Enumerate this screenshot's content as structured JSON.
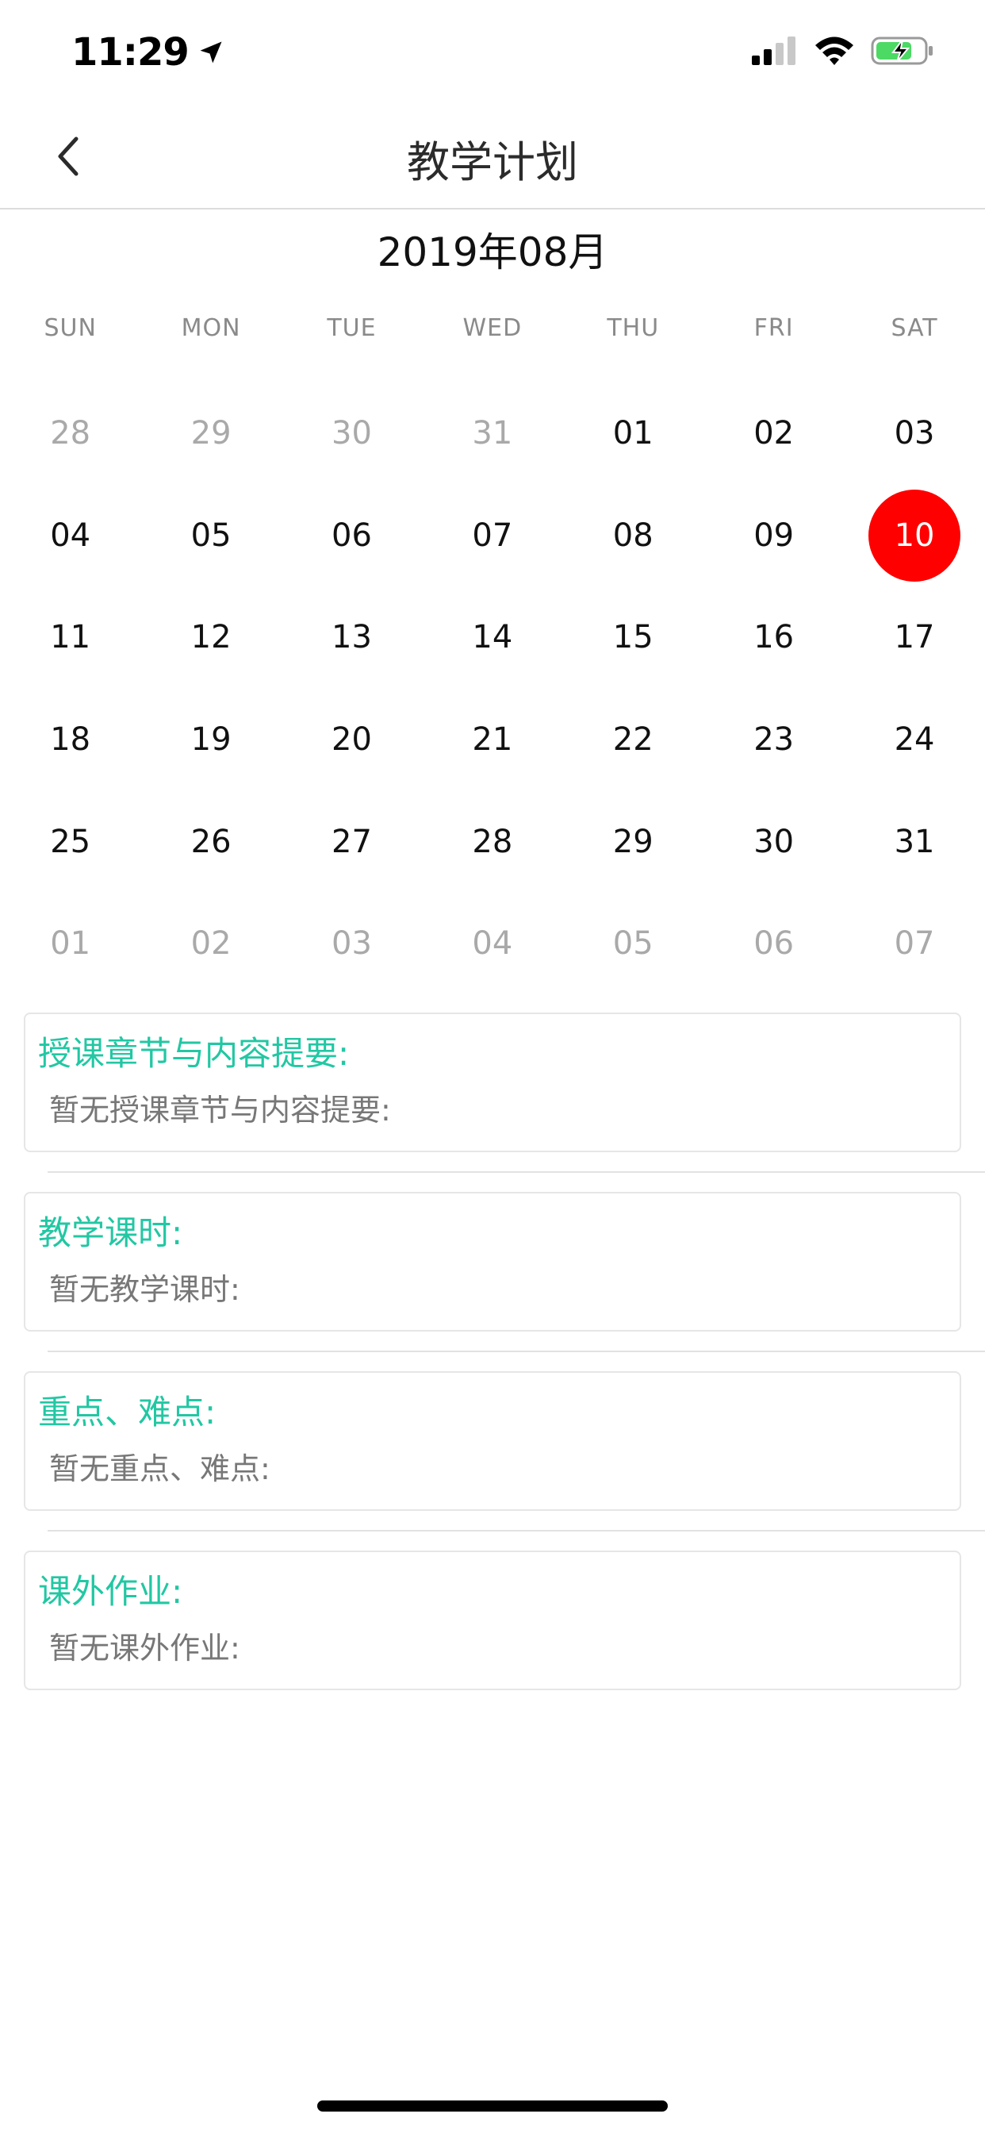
{
  "status_bar": {
    "time": "11:29",
    "icons": [
      "location-arrow-icon",
      "signal-icon",
      "wifi-icon",
      "battery-charging-icon"
    ],
    "battery_color": "#4cd964"
  },
  "nav": {
    "back_icon": "chevron-left-icon",
    "title": "教学计划"
  },
  "calendar": {
    "month_title": "2019年08月",
    "weekdays": [
      "SUN",
      "MON",
      "TUE",
      "WED",
      "THU",
      "FRI",
      "SAT"
    ],
    "selected_color": "#ff0000",
    "weeks": [
      [
        {
          "d": "28",
          "other": true
        },
        {
          "d": "29",
          "other": true
        },
        {
          "d": "30",
          "other": true
        },
        {
          "d": "31",
          "other": true
        },
        {
          "d": "01",
          "other": false
        },
        {
          "d": "02",
          "other": false
        },
        {
          "d": "03",
          "other": false
        }
      ],
      [
        {
          "d": "04",
          "other": false
        },
        {
          "d": "05",
          "other": false
        },
        {
          "d": "06",
          "other": false
        },
        {
          "d": "07",
          "other": false
        },
        {
          "d": "08",
          "other": false
        },
        {
          "d": "09",
          "other": false
        },
        {
          "d": "10",
          "other": false,
          "selected": true
        }
      ],
      [
        {
          "d": "11",
          "other": false
        },
        {
          "d": "12",
          "other": false
        },
        {
          "d": "13",
          "other": false
        },
        {
          "d": "14",
          "other": false
        },
        {
          "d": "15",
          "other": false
        },
        {
          "d": "16",
          "other": false
        },
        {
          "d": "17",
          "other": false
        }
      ],
      [
        {
          "d": "18",
          "other": false
        },
        {
          "d": "19",
          "other": false
        },
        {
          "d": "20",
          "other": false
        },
        {
          "d": "21",
          "other": false
        },
        {
          "d": "22",
          "other": false
        },
        {
          "d": "23",
          "other": false
        },
        {
          "d": "24",
          "other": false
        }
      ],
      [
        {
          "d": "25",
          "other": false
        },
        {
          "d": "26",
          "other": false
        },
        {
          "d": "27",
          "other": false
        },
        {
          "d": "28",
          "other": false
        },
        {
          "d": "29",
          "other": false
        },
        {
          "d": "30",
          "other": false
        },
        {
          "d": "31",
          "other": false
        }
      ],
      [
        {
          "d": "01",
          "other": true
        },
        {
          "d": "02",
          "other": true
        },
        {
          "d": "03",
          "other": true
        },
        {
          "d": "04",
          "other": true
        },
        {
          "d": "05",
          "other": true
        },
        {
          "d": "06",
          "other": true
        },
        {
          "d": "07",
          "other": true
        }
      ]
    ]
  },
  "cards": [
    {
      "title": "授课章节与内容提要:",
      "content": "暂无授课章节与内容提要:"
    },
    {
      "title": "教学课时:",
      "content": "暂无教学课时:"
    },
    {
      "title": "重点、难点:",
      "content": "暂无重点、难点:"
    },
    {
      "title": "课外作业:",
      "content": "暂无课外作业:"
    }
  ],
  "theme": {
    "accent": "#22c7a3",
    "muted_text": "#777777"
  }
}
